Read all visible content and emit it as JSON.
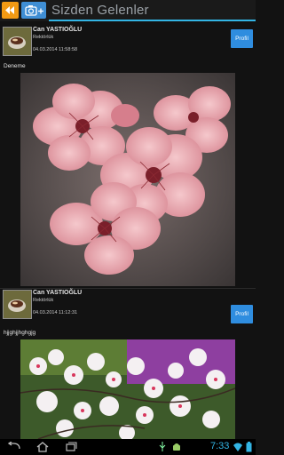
{
  "header": {
    "title": "Sizden Gelenler",
    "icons": [
      "rewind-icon",
      "camera-add-icon"
    ],
    "accent": "#33b5e5"
  },
  "posts": [
    {
      "author": "Can YASTIOĞLU",
      "department": "Rektörlük",
      "timestamp": "04.03.2014 11:58:58",
      "profile_label": "Profil",
      "text": "Deneme"
    },
    {
      "author": "Can YASTIOĞLU",
      "department": "Rektörlük",
      "timestamp": "04.03.2014 11:12:31",
      "profile_label": "Profil",
      "text": "hjjghjjhghgjg"
    }
  ],
  "status_bar": {
    "time": "7:33",
    "icons": [
      "back-icon",
      "home-icon",
      "recent-apps-icon",
      "usb-icon",
      "android-icon",
      "wifi-icon",
      "battery-icon"
    ]
  }
}
